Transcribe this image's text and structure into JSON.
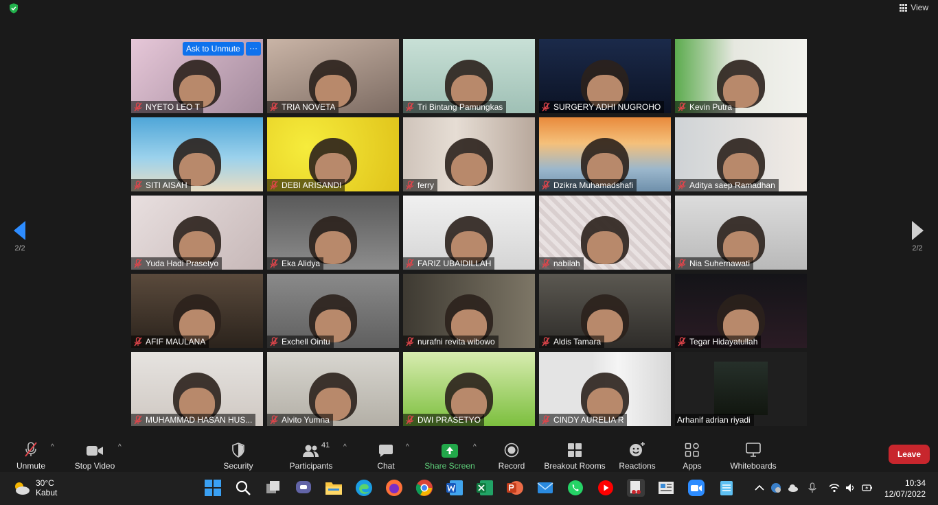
{
  "top": {
    "view_label": "View"
  },
  "hover_controls": {
    "ask_to_unmute": "Ask to Unmute",
    "more": "···"
  },
  "pager": {
    "left": "2/2",
    "right": "2/2"
  },
  "participants": [
    {
      "name": "NYETO LEO T"
    },
    {
      "name": "TRIA NOVETA"
    },
    {
      "name": "Tri Bintang Pamungkas"
    },
    {
      "name": "SURGERY ADHI NUGROHO"
    },
    {
      "name": "Kevin Putra"
    },
    {
      "name": "SITI AISAH"
    },
    {
      "name": "DEBI ARISANDI"
    },
    {
      "name": "ferry"
    },
    {
      "name": "Dzikra Muhamadshafi"
    },
    {
      "name": "Aditya saep Ramadhan"
    },
    {
      "name": "Yuda Hadi Prasetyo"
    },
    {
      "name": "Eka Alidya"
    },
    {
      "name": "FARIZ UBAIDILLAH"
    },
    {
      "name": "nabilah"
    },
    {
      "name": "Nia Suhernawati"
    },
    {
      "name": "AFIF MAULANA"
    },
    {
      "name": "Exchell Ointu"
    },
    {
      "name": "nurafni revita wibowo"
    },
    {
      "name": "Aldis Tamara"
    },
    {
      "name": "Tegar Hidayatullah"
    },
    {
      "name": "MUHAMMAD HASAN HUS..."
    },
    {
      "name": "Alvito Yumna"
    },
    {
      "name": "DWI PRASETYO"
    },
    {
      "name": "CINDY AURELIA R"
    },
    {
      "name": "Arhanif adrian riyadi"
    }
  ],
  "toolbar": {
    "unmute": "Unmute",
    "stop_video": "Stop Video",
    "security": "Security",
    "participants": "Participants",
    "participants_count": "41",
    "chat": "Chat",
    "share_screen": "Share Screen",
    "record": "Record",
    "breakout_rooms": "Breakout Rooms",
    "reactions": "Reactions",
    "apps": "Apps",
    "whiteboards": "Whiteboards",
    "leave": "Leave"
  },
  "taskbar": {
    "temperature": "30°C",
    "weather": "Kabut",
    "time": "10:34",
    "date": "12/07/2022"
  },
  "colors": {
    "accent_blue": "#0e72ed",
    "share_green": "#22a84a",
    "leave_red": "#c8262d",
    "mic_off_red": "#e0454b"
  }
}
